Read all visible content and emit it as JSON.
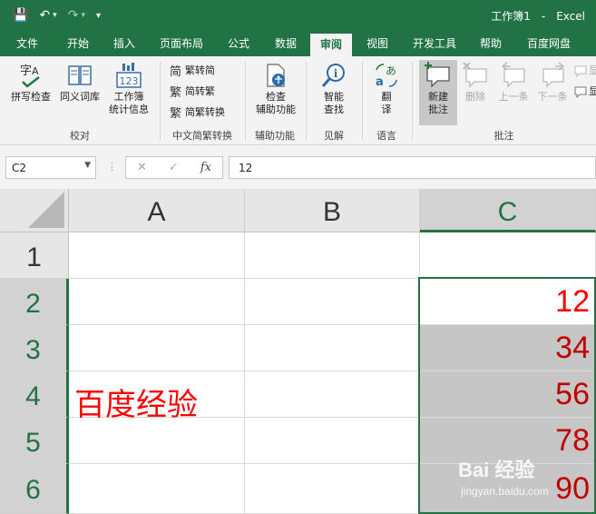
{
  "title_bar": {
    "quick_access": {
      "save": "💾",
      "undo": "↶",
      "undo_dd": "▾",
      "redo": "↷",
      "redo_dd": "▾",
      "customize": "▾"
    },
    "doc_title": "工作簿1",
    "separator": "-",
    "app_name": "Excel"
  },
  "ribbon_tabs": [
    "文件",
    "开始",
    "插入",
    "页面布局",
    "公式",
    "数据",
    "审阅",
    "视图",
    "开发工具",
    "帮助",
    "百度网盘"
  ],
  "active_tab": "审阅",
  "ribbon": {
    "proofing": {
      "label": "校对",
      "spell_check": "拼写检查",
      "thesaurus": "同义词库",
      "stats_line1": "工作簿",
      "stats_line2": "统计信息",
      "stats_icon_text": "123"
    },
    "chinese_conversion": {
      "label": "中文简繁转换",
      "trad_to_simp": "繁转简",
      "simp_to_trad": "简转繁",
      "convert": "简繁转换"
    },
    "accessibility": {
      "label": "辅助功能",
      "check_line1": "检查",
      "check_line2": "辅助功能"
    },
    "insights": {
      "label": "见解",
      "smart_line1": "智能",
      "smart_line2": "查找"
    },
    "language": {
      "label": "语言",
      "translate_line1": "翻",
      "translate_line2": "译"
    },
    "comments": {
      "label": "批注",
      "new_line1": "新建",
      "new_line2": "批注",
      "delete": "删除",
      "previous": "上一条",
      "next": "下一条",
      "show1": "显",
      "show2": "显"
    }
  },
  "formula_bar": {
    "name_box": "C2",
    "input_value": "12",
    "fx": "fx",
    "cancel": "✕",
    "enter": "✓",
    "dots": "⋮"
  },
  "sheet": {
    "columns": [
      "A",
      "B",
      "C"
    ],
    "rows": [
      "1",
      "2",
      "3",
      "4",
      "5",
      "6"
    ],
    "selected_column": "C",
    "selected_rows": [
      "2",
      "3",
      "4",
      "5",
      "6"
    ],
    "c_values": [
      "12",
      "34",
      "56",
      "78",
      "90"
    ],
    "a4_text": "百度经验"
  },
  "watermark": {
    "brand": "Bai 经验",
    "url": "jingyan.baidu.com"
  },
  "colors": {
    "accent": "#217346",
    "value_red": "#ff0000",
    "selection_gray": "#c6c6c6"
  }
}
